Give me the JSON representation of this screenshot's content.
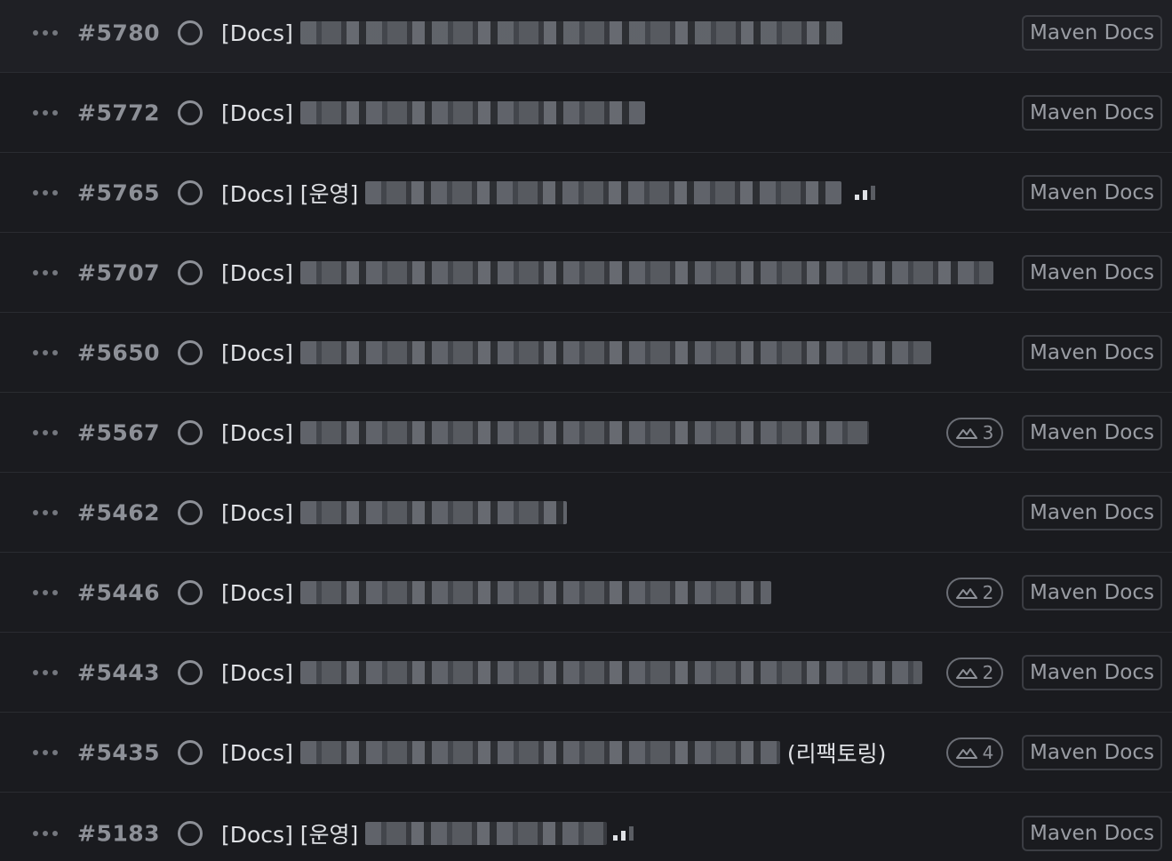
{
  "issues": [
    {
      "number": "#5780",
      "prefix": "[Docs]",
      "suffix": "",
      "estimate": "",
      "label": "Maven Docs"
    },
    {
      "number": "#5772",
      "prefix": "[Docs]",
      "suffix": "",
      "estimate": "",
      "label": "Maven Docs"
    },
    {
      "number": "#5765",
      "prefix": "[Docs] [운영]",
      "suffix": "",
      "estimate": "",
      "label": "Maven Docs"
    },
    {
      "number": "#5707",
      "prefix": "[Docs]",
      "suffix": "",
      "estimate": "",
      "label": "Maven Docs"
    },
    {
      "number": "#5650",
      "prefix": "[Docs]",
      "suffix": "",
      "estimate": "",
      "label": "Maven Docs"
    },
    {
      "number": "#5567",
      "prefix": "[Docs]",
      "suffix": "",
      "estimate": "3",
      "label": "Maven Docs"
    },
    {
      "number": "#5462",
      "prefix": "[Docs]",
      "suffix": "",
      "estimate": "",
      "label": "Maven Docs"
    },
    {
      "number": "#5446",
      "prefix": "[Docs]",
      "suffix": "",
      "estimate": "2",
      "label": "Maven Docs"
    },
    {
      "number": "#5443",
      "prefix": "[Docs]",
      "suffix": "",
      "estimate": "2",
      "label": "Maven Docs"
    },
    {
      "number": "#5435",
      "prefix": "[Docs]",
      "suffix": "(리팩토링)",
      "estimate": "4",
      "label": "Maven Docs"
    },
    {
      "number": "#5183",
      "prefix": "[Docs] [운영]",
      "suffix": "",
      "estimate": "",
      "label": "Maven Docs"
    }
  ],
  "icons": {
    "more": "more-horizontal-icon",
    "status": "circle-status-icon",
    "priority": "priority-bars-icon",
    "estimate": "mountain-estimate-icon"
  },
  "colors": {
    "background": "#1a1b1f",
    "divider": "#2a2c31",
    "text": "#dfe1e5",
    "muted": "#8d9097"
  }
}
